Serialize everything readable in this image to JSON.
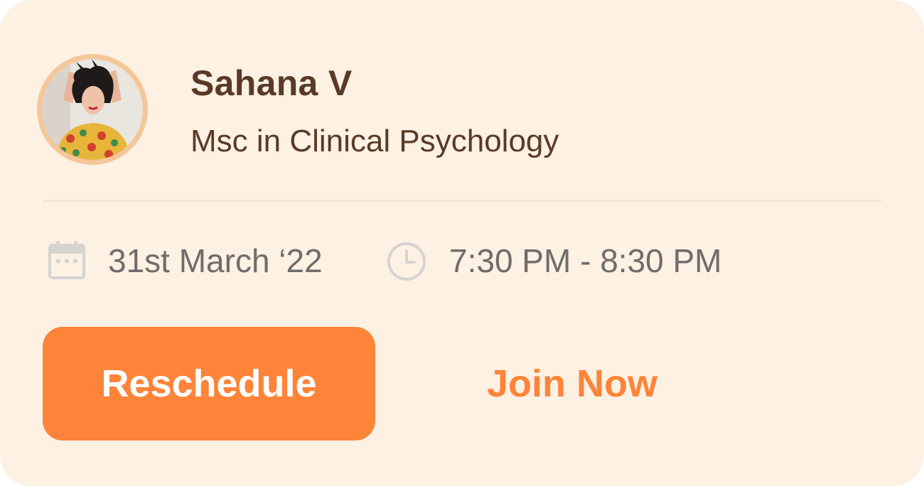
{
  "session": {
    "therapist_name": "Sahana V",
    "qualification": "Msc in Clinical Psychology",
    "date": "31st March ‘22",
    "time": "7:30 PM - 8:30 PM"
  },
  "actions": {
    "reschedule_label": "Reschedule",
    "join_label": "Join Now"
  },
  "icons": {
    "date": "calendar-icon",
    "time": "clock-icon"
  },
  "colors": {
    "card_background": "#fdf1e4",
    "accent": "#fd8439",
    "name_text": "#5a3a26",
    "meta_text": "#6f6c69",
    "icon": "#d6d3d0",
    "avatar_ring": "#f5c698"
  }
}
